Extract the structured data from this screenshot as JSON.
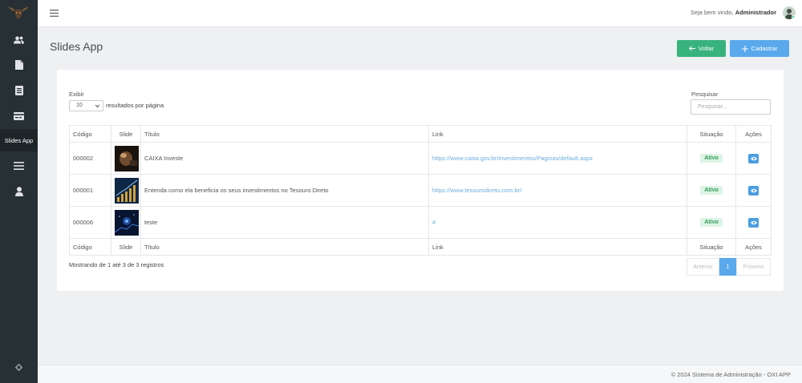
{
  "sidebar": {
    "items": [
      {
        "icon": "users-icon"
      },
      {
        "icon": "file-icon"
      },
      {
        "icon": "document-icon"
      },
      {
        "icon": "card-icon"
      },
      {
        "label": "Slides App",
        "active": true
      },
      {
        "icon": "menu-icon"
      },
      {
        "icon": "user-icon"
      }
    ],
    "bottom_icon": "gear-icon"
  },
  "topbar": {
    "welcome_prefix": "Seja bem vindo,",
    "user_name": "Administrador"
  },
  "page": {
    "title": "Slides App",
    "back_label": "Voltar",
    "new_label": "Cadastrar"
  },
  "controls": {
    "show_label": "Exibir",
    "page_length": "10",
    "per_page_label": "resultados por página",
    "search_label": "Pesquisar",
    "search_placeholder": "Pesquisar..."
  },
  "table": {
    "columns": [
      "Código",
      "Slide",
      "Título",
      "Link",
      "Situação",
      "Ações"
    ],
    "rows": [
      {
        "code": "000002",
        "title": "CAIXA Investe",
        "link": "https://www.caixa.gov.br/investimentos/Paginas/default.aspx",
        "status": "Ativo"
      },
      {
        "code": "000001",
        "title": "Entenda como ela beneficia os seus investimentos no Tesouro Direto",
        "link": "https://www.tesourodireto.com.br/",
        "status": "Ativo"
      },
      {
        "code": "000006",
        "title": "teste",
        "link": "#",
        "status": "Ativo"
      }
    ]
  },
  "pagination": {
    "info": "Mostrando de 1 até 3 de 3 registros",
    "prev": "Anterior",
    "current": "1",
    "next": "Próximo"
  },
  "footer": {
    "text": "© 2024 Sistema de Administração - OXI APP"
  },
  "colors": {
    "sidebar": "#273035",
    "back_button": "#39b37d",
    "new_button": "#5aa9ec",
    "link": "#6aaee0",
    "status_active": "#2d9a56"
  }
}
